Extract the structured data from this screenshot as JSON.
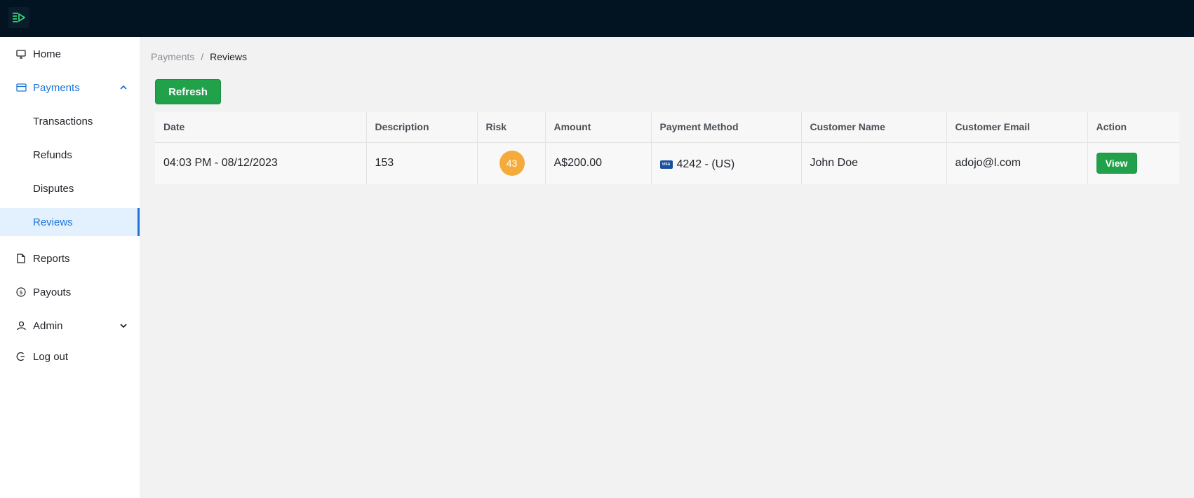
{
  "sidebar": {
    "items": [
      {
        "label": "Home",
        "icon": "monitor-icon"
      },
      {
        "label": "Payments",
        "icon": "credit-card-icon"
      },
      {
        "label": "Transactions"
      },
      {
        "label": "Refunds"
      },
      {
        "label": "Disputes"
      },
      {
        "label": "Reviews"
      },
      {
        "label": "Reports",
        "icon": "document-icon"
      },
      {
        "label": "Payouts",
        "icon": "dollar-circle-icon"
      },
      {
        "label": "Admin",
        "icon": "user-icon"
      },
      {
        "label": "Log out",
        "icon": "logout-icon"
      }
    ]
  },
  "breadcrumb": {
    "parent": "Payments",
    "separator": "/",
    "current": "Reviews"
  },
  "toolbar": {
    "refresh_label": "Refresh"
  },
  "table": {
    "columns": [
      "Date",
      "Description",
      "Risk",
      "Amount",
      "Payment Method",
      "Customer Name",
      "Customer Email",
      "Action"
    ],
    "rows": [
      {
        "date": "04:03 PM - 08/12/2023",
        "description": "153",
        "risk": "43",
        "amount": "A$200.00",
        "card_brand": "VISA",
        "payment_method": "4242  - (US)",
        "customer_name": "John Doe",
        "customer_email": "adojo@l.com",
        "action_label": "View"
      }
    ]
  },
  "colors": {
    "topbar": "#021422",
    "accent": "#1e73d8",
    "success": "#21a24a",
    "risk": "#f5ab3b"
  }
}
